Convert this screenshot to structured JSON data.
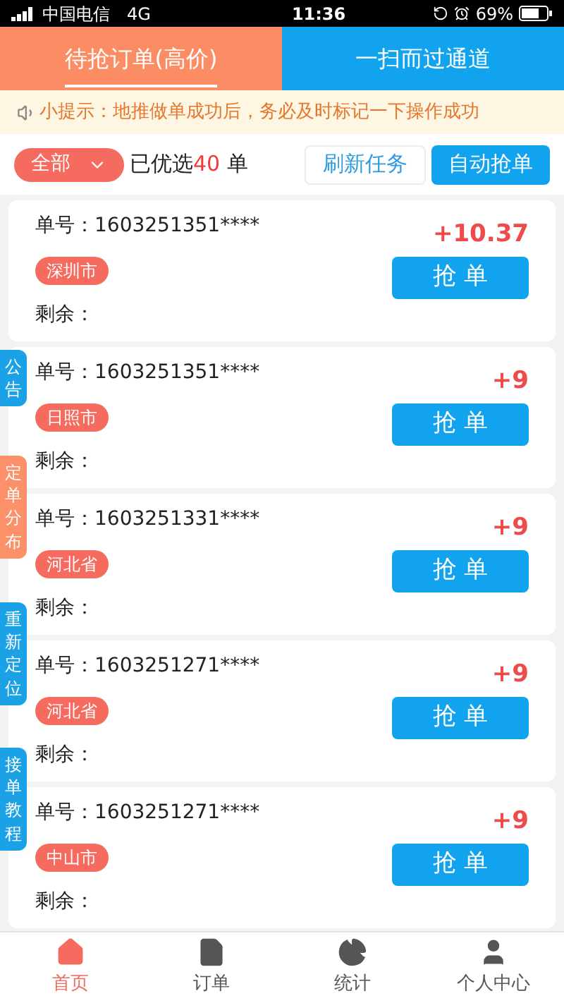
{
  "status_bar": {
    "carrier": "中国电信",
    "network": "4G",
    "time": "11:36",
    "battery_percent": "69%"
  },
  "tabs": [
    {
      "label": "待抢订单(高价)",
      "selected": true
    },
    {
      "label": "一扫而过通道",
      "selected": false
    }
  ],
  "tip": "小提示：地推做单成功后，务必及时标记一下操作成功",
  "filter": {
    "dropdown": "全部",
    "summary_prefix": "已优选",
    "summary_count": "40",
    "summary_suffix": "单",
    "buttons": [
      {
        "label": "刷新任务",
        "kind": "outline"
      },
      {
        "label": "自动抢单",
        "kind": "filled"
      }
    ]
  },
  "orders": [
    {
      "order_no": "单号：1603251351****",
      "city": "深圳市",
      "remaining": "剩余：",
      "price": "+10.37",
      "button": "抢 单"
    },
    {
      "order_no": "单号：1603251351****",
      "city": "日照市",
      "remaining": "剩余：",
      "price": "+9",
      "button": "抢 单"
    },
    {
      "order_no": "单号：1603251331****",
      "city": "河北省",
      "remaining": "剩余：",
      "price": "+9",
      "button": "抢 单"
    },
    {
      "order_no": "单号：1603251271****",
      "city": "河北省",
      "remaining": "剩余：",
      "price": "+9",
      "button": "抢 单"
    },
    {
      "order_no": "单号：1603251271****",
      "city": "中山市",
      "remaining": "剩余：",
      "price": "+9",
      "button": "抢 单"
    }
  ],
  "side_tabs": [
    {
      "label": "公告",
      "color": "#1ba1e6"
    },
    {
      "label": "定单分布",
      "color": "#fc9068"
    },
    {
      "label": "重新定位",
      "color": "#1ba1e6"
    },
    {
      "label": "接单教程",
      "color": "#1ba1e6"
    }
  ],
  "bottom_nav": [
    {
      "label": "首页",
      "selected": true,
      "kind": "home"
    },
    {
      "label": "订单",
      "selected": false,
      "kind": "orders"
    },
    {
      "label": "统计",
      "selected": false,
      "kind": "stats"
    },
    {
      "label": "个人中心",
      "selected": false,
      "kind": "profile"
    }
  ]
}
